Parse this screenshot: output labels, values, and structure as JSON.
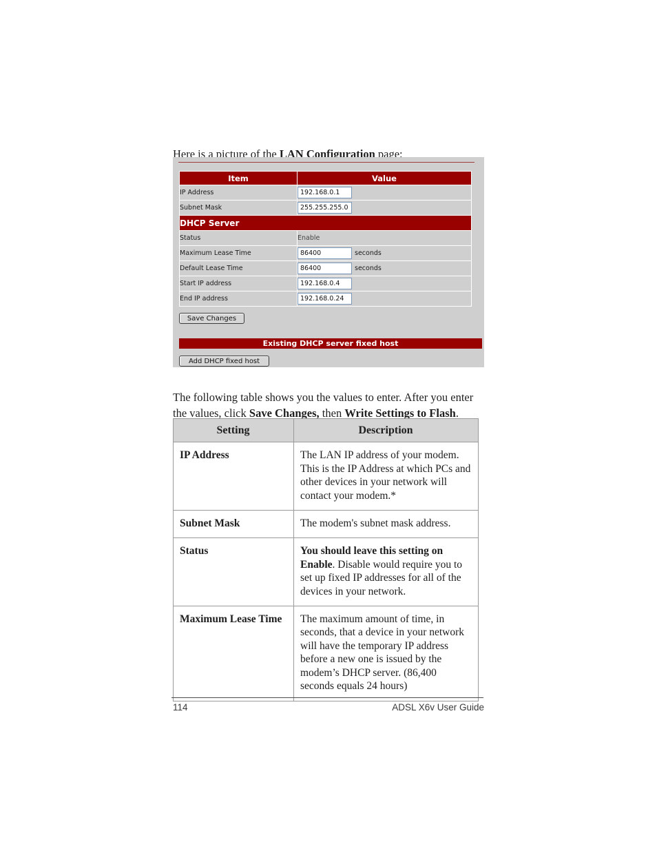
{
  "intro": {
    "before": "Here is a picture of the ",
    "bold": "LAN Configuration",
    "after": " page:"
  },
  "router_screenshot": {
    "table": {
      "headers": [
        "Item",
        "Value"
      ],
      "rows": [
        {
          "label": "IP Address",
          "type": "input",
          "value": "192.168.0.1",
          "unit": ""
        },
        {
          "label": "Subnet Mask",
          "type": "input",
          "value": "255.255.255.0",
          "unit": ""
        }
      ],
      "section_title": "DHCP Server",
      "dhcp_rows": [
        {
          "label": "Status",
          "type": "text",
          "value": "Enable",
          "unit": ""
        },
        {
          "label": "Maximum Lease Time",
          "type": "input",
          "value": "86400",
          "unit": "seconds"
        },
        {
          "label": "Default Lease Time",
          "type": "input",
          "value": "86400",
          "unit": "seconds"
        },
        {
          "label": "Start IP address",
          "type": "input",
          "value": "192.168.0.4",
          "unit": ""
        },
        {
          "label": "End IP address",
          "type": "input",
          "value": "192.168.0.24",
          "unit": ""
        }
      ]
    },
    "save_button": "Save Changes",
    "existing_bar": "Existing DHCP server fixed host",
    "add_button": "Add DHCP fixed host",
    "colors": {
      "header_maroon": "#990000",
      "panel_gray": "#cfcfcf",
      "field_border": "#7a96b8"
    }
  },
  "body_paragraph": {
    "part1": "The following table shows you the values to enter. After you enter the values, click ",
    "bold1": "Save Changes,",
    "part2": " then ",
    "bold2": "Write Settings to Flash",
    "part3": "."
  },
  "settings_table": {
    "headers": [
      "Setting",
      "Description"
    ],
    "rows": [
      {
        "setting": "IP Address",
        "description": "The LAN IP address of your modem. This is the IP Address at which PCs and other devices in your network will contact your modem.*"
      },
      {
        "setting": "Subnet Mask",
        "description": "The modem's subnet mask address."
      },
      {
        "setting": "Status",
        "description_bold": "You should leave this setting on Enable",
        "description": ". Disable would require you to set up fixed IP addresses for all of the devices in your network."
      },
      {
        "setting": "Maximum Lease Time",
        "description": "The maximum amount of time, in seconds, that a device in your network will have the temporary IP address before a new one is issued by the modem’s DHCP server. (86,400 seconds equals 24 hours)"
      }
    ]
  },
  "footer": {
    "page_number": "114",
    "guide_title": "ADSL X6v User Guide"
  }
}
